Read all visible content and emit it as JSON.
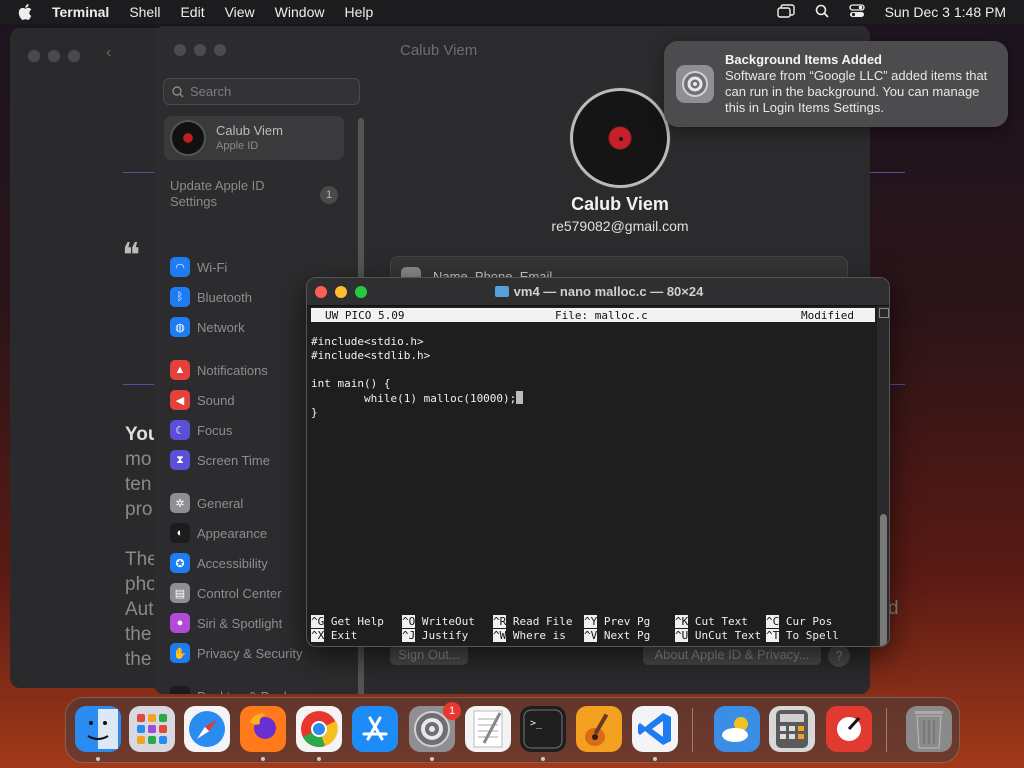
{
  "menubar": {
    "app": "Terminal",
    "items": [
      "Shell",
      "Edit",
      "View",
      "Window",
      "Help"
    ],
    "clock": "Sun Dec 3  1:48 PM"
  },
  "background_window": {
    "quote_mark": "❝",
    "lines": [
      "You",
      "mo",
      "ten",
      "pro",
      "The",
      "pho",
      "Aut",
      "the",
      "the"
    ],
    "right_char": "d"
  },
  "settings": {
    "header_title": "Calub Viem",
    "search_placeholder": "Search",
    "account": {
      "name": "Calub Viem",
      "subtitle": "Apple ID"
    },
    "update": {
      "label": "Update Apple ID Settings",
      "count": "1"
    },
    "sidebar_items": [
      {
        "label": "Wi-Fi",
        "icon": "wifi-icon",
        "color": "#1e7cf2"
      },
      {
        "label": "Bluetooth",
        "icon": "bluetooth-icon",
        "color": "#1e7cf2"
      },
      {
        "label": "Network",
        "icon": "globe-icon",
        "color": "#1e7cf2"
      },
      {
        "label": "Notifications",
        "icon": "bell-icon",
        "color": "#e5413a"
      },
      {
        "label": "Sound",
        "icon": "speaker-icon",
        "color": "#e5413a"
      },
      {
        "label": "Focus",
        "icon": "moon-icon",
        "color": "#5b4fd8"
      },
      {
        "label": "Screen Time",
        "icon": "hourglass-icon",
        "color": "#5b4fd8"
      },
      {
        "label": "General",
        "icon": "gear-icon",
        "color": "#8e8e93"
      },
      {
        "label": "Appearance",
        "icon": "appearance-icon",
        "color": "#1c1c1e"
      },
      {
        "label": "Accessibility",
        "icon": "accessibility-icon",
        "color": "#1e7cf2"
      },
      {
        "label": "Control Center",
        "icon": "control-center-icon",
        "color": "#8e8e93"
      },
      {
        "label": "Siri & Spotlight",
        "icon": "siri-icon",
        "color": "#b04bd8"
      },
      {
        "label": "Privacy & Security",
        "icon": "hand-icon",
        "color": "#1e7cf2"
      },
      {
        "label": "Desktop & Dock",
        "icon": "dock-icon",
        "color": "#1c1c1e"
      }
    ],
    "profile": {
      "name": "Calub Viem",
      "email": "re579082@gmail.com"
    },
    "name_phone_email": "Name, Phone, Email",
    "sign_out": "Sign Out...",
    "about": "About Apple ID & Privacy...",
    "help": "?"
  },
  "notification": {
    "title": "Background Items Added",
    "body": "Software from “Google LLC” added items that can run in the background. You can manage this in Login Items Settings."
  },
  "terminal": {
    "title": "vm4 — nano malloc.c — 80×24",
    "nano_version": "UW PICO 5.09",
    "file": "File: malloc.c",
    "status": "Modified",
    "code": "#include<stdio.h>\n#include<stdlib.h>\n\nint main() {\n        while(1) malloc(10000);",
    "code_end": "}",
    "shortcuts_row1": [
      {
        "key": "^G",
        "label": "Get Help"
      },
      {
        "key": "^O",
        "label": "WriteOut"
      },
      {
        "key": "^R",
        "label": "Read File"
      },
      {
        "key": "^Y",
        "label": "Prev Pg"
      },
      {
        "key": "^K",
        "label": "Cut Text"
      },
      {
        "key": "^C",
        "label": "Cur Pos"
      }
    ],
    "shortcuts_row2": [
      {
        "key": "^X",
        "label": "Exit"
      },
      {
        "key": "^J",
        "label": "Justify"
      },
      {
        "key": "^W",
        "label": "Where is"
      },
      {
        "key": "^V",
        "label": "Next Pg"
      },
      {
        "key": "^U",
        "label": "UnCut Text"
      },
      {
        "key": "^T",
        "label": "To Spell"
      }
    ]
  },
  "dock": {
    "apps": [
      {
        "name": "finder-icon",
        "color": "#2a8cf0",
        "running": true
      },
      {
        "name": "launchpad-icon",
        "color": "#d8d8e0",
        "running": false
      },
      {
        "name": "safari-icon",
        "color": "#f4f4f6",
        "running": false
      },
      {
        "name": "firefox-icon",
        "color": "#ff7a1a",
        "running": true
      },
      {
        "name": "chrome-icon",
        "color": "#f4f4f4",
        "running": true
      },
      {
        "name": "app-store-icon",
        "color": "#1e8cf6",
        "running": false
      },
      {
        "name": "system-settings-icon",
        "color": "#8e8e93",
        "running": true,
        "badge": "1"
      },
      {
        "name": "textedit-icon",
        "color": "#f4f4f4",
        "running": false
      },
      {
        "name": "terminal-icon",
        "color": "#1e1e1e",
        "running": true
      },
      {
        "name": "garageband-icon",
        "color": "#f4a020",
        "running": false
      },
      {
        "name": "vscode-icon",
        "color": "#f4f4f6",
        "running": true
      },
      {
        "name": "weather-icon",
        "color": "#3a8ee6",
        "running": false
      },
      {
        "name": "calculator-icon",
        "color": "#d8d8d8",
        "running": false
      },
      {
        "name": "instruments-icon",
        "color": "#e23a30",
        "running": false
      },
      {
        "name": "trash-icon",
        "color": "#8a8a8a",
        "running": false
      }
    ]
  }
}
